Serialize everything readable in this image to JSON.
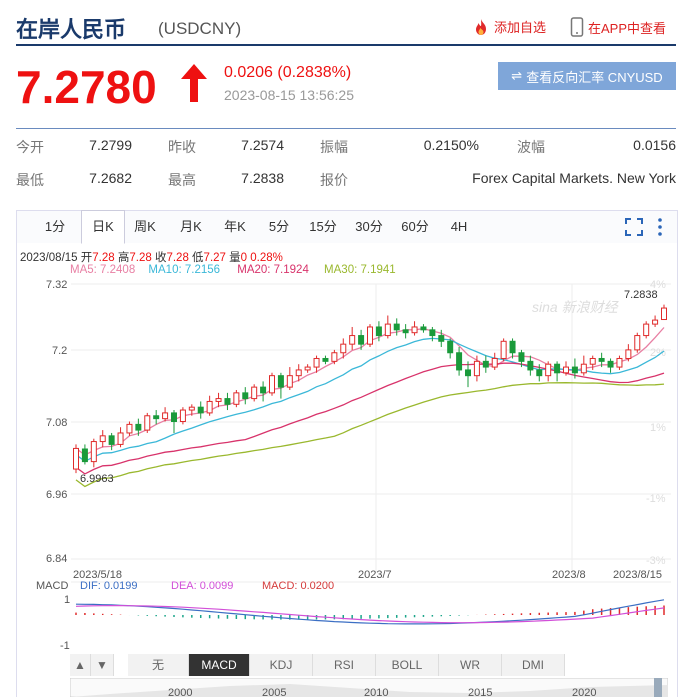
{
  "header": {
    "title": "在岸人民币",
    "code": "(USDCNY)",
    "add_watch": "添加自选",
    "app_view": "在APP中查看"
  },
  "quote": {
    "price": "7.2780",
    "change": "0.0206 (0.2838%)",
    "time": "2023-08-15 13:56:25",
    "reverse_rate": "查看反向汇率 CNYUSD"
  },
  "stats": [
    {
      "label": "今开",
      "value": "7.2799"
    },
    {
      "label": "昨收",
      "value": "7.2574"
    },
    {
      "label": "振幅",
      "value": "0.2150%"
    },
    {
      "label": "波幅",
      "value": "0.0156"
    },
    {
      "label": "最低",
      "value": "7.2682"
    },
    {
      "label": "最高",
      "value": "7.2838"
    },
    {
      "label": "报价",
      "value": "Forex Capital Markets. New York"
    }
  ],
  "tabs": [
    "1分",
    "日K",
    "周K",
    "月K",
    "年K",
    "5分",
    "15分",
    "30分",
    "60分",
    "4H"
  ],
  "active_tab": "日K",
  "kline_info": {
    "date": "2023/08/15",
    "open_label": "开",
    "open": "7.28",
    "high_label": "高",
    "high": "7.28",
    "close_label": "收",
    "close": "7.28",
    "low_label": "低",
    "low": "7.27",
    "vol_label": "量",
    "vol": "0",
    "pct": "0.28%"
  },
  "ma": [
    {
      "text": "MA5: 7.2408",
      "color": "#e87fa3"
    },
    {
      "text": "MA10: 7.2156",
      "color": "#3bb8d8"
    },
    {
      "text": "MA20: 7.1924",
      "color": "#d8336b"
    },
    {
      "text": "MA30: 7.1941",
      "color": "#9ab82e"
    }
  ],
  "chart_data": {
    "type": "candlestick",
    "y_ticks": [
      "7.32",
      "7.2",
      "7.08",
      "6.96",
      "6.84"
    ],
    "y_range": [
      6.84,
      7.32
    ],
    "pct_ticks": [
      "4%",
      "2%",
      "1%",
      "-1%",
      "-3%"
    ],
    "x_ticks": [
      "2023/5/18",
      "2023/7",
      "2023/8",
      "2023/8/15"
    ],
    "annotations": {
      "max": "7.2838",
      "min": "6.9963"
    },
    "watermark": "sina 新浪财经",
    "candles": [
      [
        6.997,
        7.033,
        6.99,
        7.04
      ],
      [
        7.032,
        7.01,
        7.005,
        7.04
      ],
      [
        7.01,
        7.045,
        7.0,
        7.05
      ],
      [
        7.045,
        7.055,
        7.035,
        7.065
      ],
      [
        7.055,
        7.04,
        7.03,
        7.06
      ],
      [
        7.04,
        7.06,
        7.035,
        7.07
      ],
      [
        7.06,
        7.075,
        7.055,
        7.08
      ],
      [
        7.075,
        7.065,
        7.055,
        7.085
      ],
      [
        7.065,
        7.09,
        7.06,
        7.095
      ],
      [
        7.09,
        7.085,
        7.075,
        7.1
      ],
      [
        7.085,
        7.095,
        7.08,
        7.105
      ],
      [
        7.095,
        7.08,
        7.06,
        7.1
      ],
      [
        7.08,
        7.1,
        7.075,
        7.105
      ],
      [
        7.1,
        7.105,
        7.09,
        7.11
      ],
      [
        7.105,
        7.095,
        7.085,
        7.115
      ],
      [
        7.095,
        7.115,
        7.09,
        7.125
      ],
      [
        7.115,
        7.12,
        7.105,
        7.13
      ],
      [
        7.12,
        7.11,
        7.1,
        7.13
      ],
      [
        7.11,
        7.13,
        7.105,
        7.135
      ],
      [
        7.13,
        7.12,
        7.11,
        7.14
      ],
      [
        7.12,
        7.14,
        7.115,
        7.145
      ],
      [
        7.14,
        7.13,
        7.115,
        7.15
      ],
      [
        7.13,
        7.16,
        7.125,
        7.165
      ],
      [
        7.16,
        7.14,
        7.12,
        7.165
      ],
      [
        7.14,
        7.16,
        7.135,
        7.175
      ],
      [
        7.16,
        7.17,
        7.15,
        7.18
      ],
      [
        7.17,
        7.175,
        7.165,
        7.18
      ],
      [
        7.175,
        7.19,
        7.165,
        7.195
      ],
      [
        7.19,
        7.185,
        7.18,
        7.195
      ],
      [
        7.185,
        7.2,
        7.18,
        7.205
      ],
      [
        7.2,
        7.215,
        7.19,
        7.225
      ],
      [
        7.215,
        7.23,
        7.205,
        7.245
      ],
      [
        7.23,
        7.215,
        7.205,
        7.24
      ],
      [
        7.215,
        7.245,
        7.21,
        7.25
      ],
      [
        7.245,
        7.23,
        7.22,
        7.255
      ],
      [
        7.23,
        7.25,
        7.225,
        7.265
      ],
      [
        7.25,
        7.24,
        7.23,
        7.26
      ],
      [
        7.24,
        7.235,
        7.225,
        7.25
      ],
      [
        7.235,
        7.245,
        7.23,
        7.255
      ],
      [
        7.245,
        7.24,
        7.235,
        7.25
      ],
      [
        7.24,
        7.23,
        7.22,
        7.245
      ],
      [
        7.23,
        7.22,
        7.21,
        7.24
      ],
      [
        7.22,
        7.2,
        7.19,
        7.225
      ],
      [
        7.2,
        7.17,
        7.16,
        7.21
      ],
      [
        7.17,
        7.16,
        7.14,
        7.185
      ],
      [
        7.16,
        7.185,
        7.15,
        7.195
      ],
      [
        7.185,
        7.175,
        7.165,
        7.195
      ],
      [
        7.175,
        7.19,
        7.17,
        7.2
      ],
      [
        7.19,
        7.22,
        7.185,
        7.225
      ],
      [
        7.22,
        7.2,
        7.19,
        7.225
      ],
      [
        7.2,
        7.185,
        7.175,
        7.205
      ],
      [
        7.185,
        7.17,
        7.16,
        7.195
      ],
      [
        7.17,
        7.16,
        7.15,
        7.18
      ],
      [
        7.16,
        7.18,
        7.15,
        7.185
      ],
      [
        7.18,
        7.165,
        7.15,
        7.185
      ],
      [
        7.165,
        7.175,
        7.16,
        7.185
      ],
      [
        7.175,
        7.165,
        7.155,
        7.19
      ],
      [
        7.165,
        7.18,
        7.16,
        7.195
      ],
      [
        7.18,
        7.19,
        7.17,
        7.195
      ],
      [
        7.19,
        7.185,
        7.175,
        7.2
      ],
      [
        7.185,
        7.175,
        7.165,
        7.19
      ],
      [
        7.175,
        7.19,
        7.17,
        7.195
      ],
      [
        7.19,
        7.205,
        7.185,
        7.215
      ],
      [
        7.205,
        7.23,
        7.2,
        7.235
      ],
      [
        7.23,
        7.25,
        7.225,
        7.255
      ],
      [
        7.25,
        7.257,
        7.245,
        7.265
      ],
      [
        7.258,
        7.278,
        7.268,
        7.284
      ]
    ]
  },
  "macd": {
    "label": "MACD",
    "dif": "DIF: 0.0199",
    "dea": "DEA: 0.0099",
    "macd": "MACD: 0.0200",
    "y_ticks": [
      "1",
      "-1"
    ]
  },
  "indicators": [
    "无",
    "MACD",
    "KDJ",
    "RSI",
    "BOLL",
    "WR",
    "DMI"
  ],
  "active_indicator": "MACD",
  "timeline_years": [
    "2000",
    "2005",
    "2010",
    "2015",
    "2020"
  ]
}
